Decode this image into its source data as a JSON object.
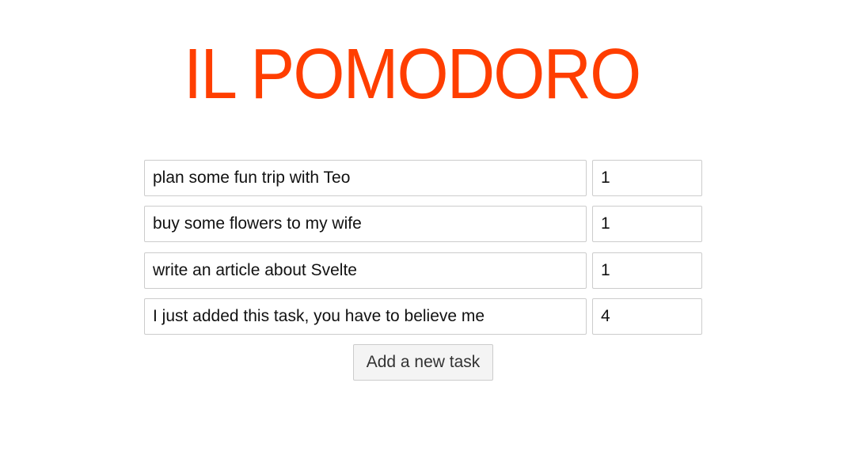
{
  "header": {
    "title": "IL POMODORO"
  },
  "theme": {
    "accent": "#ff3e00"
  },
  "tasks": [
    {
      "description": "plan some fun trip with Teo",
      "pomodoros": "1"
    },
    {
      "description": "buy some flowers to my wife",
      "pomodoros": "1"
    },
    {
      "description": "write an article about Svelte",
      "pomodoros": "1"
    },
    {
      "description": "I just added this task, you have to believe me",
      "pomodoros": "4"
    }
  ],
  "actions": {
    "add_task_label": "Add a new task"
  }
}
